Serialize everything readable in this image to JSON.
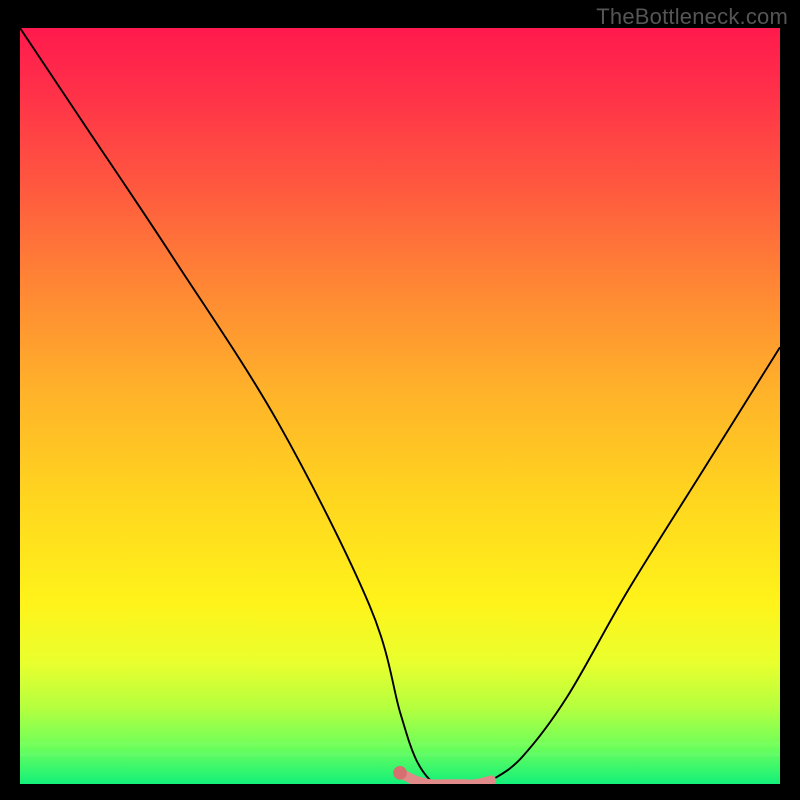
{
  "watermark": "TheBottleneck.com",
  "chart_data": {
    "type": "line",
    "title": "",
    "xlabel": "",
    "ylabel": "",
    "xlim": [
      0,
      100
    ],
    "ylim": [
      0,
      100
    ],
    "series": [
      {
        "name": "bottleneck-curve",
        "x": [
          0,
          8,
          20,
          34,
          46,
          50,
          52,
          54,
          56,
          58,
          60,
          62,
          66,
          72,
          80,
          90,
          100
        ],
        "values": [
          100,
          88,
          70,
          48,
          24,
          10,
          4,
          1,
          0,
          0,
          0,
          1,
          4,
          12,
          26,
          42,
          58
        ]
      },
      {
        "name": "bottom-band-highlight",
        "x": [
          50,
          52,
          54,
          56,
          58,
          60,
          62
        ],
        "values": [
          2,
          1,
          0.5,
          0.5,
          0.5,
          0.5,
          1
        ]
      }
    ],
    "gradient_note": "Background encodes severity: red (top/high) through orange/yellow to green (bottom/low)."
  },
  "colors": {
    "curve": "#000000",
    "band_highlight": "#e08a8a",
    "band_highlight_dot": "#d66f6f"
  }
}
